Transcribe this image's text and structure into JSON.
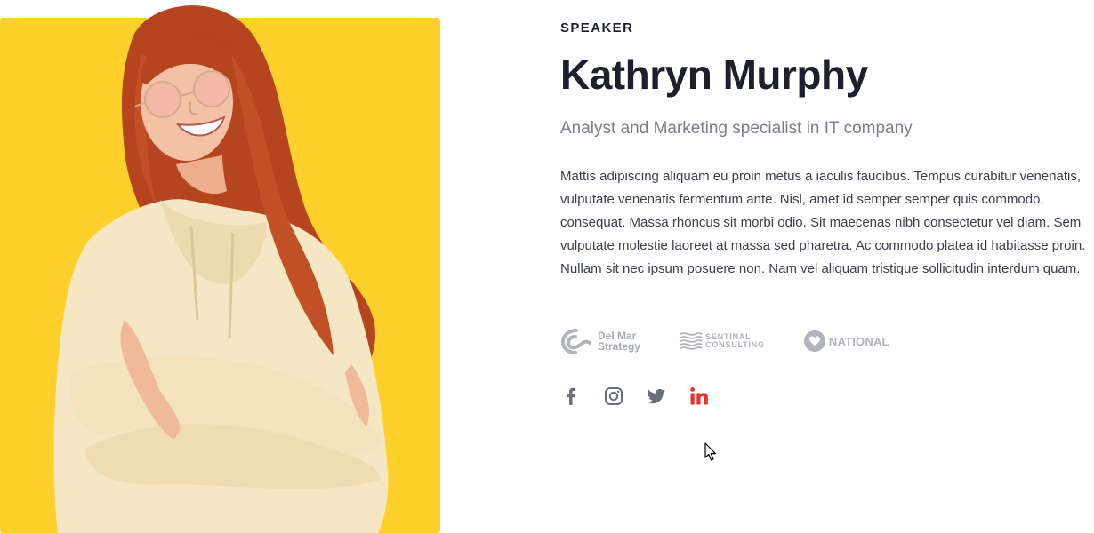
{
  "speaker": {
    "eyebrow": "SPEAKER",
    "name": "Kathryn Murphy",
    "role": "Analyst and Marketing specialist in IT company",
    "bio": "Mattis adipiscing aliquam eu proin metus a iaculis faucibus. Tempus curabitur venenatis, vulputate venenatis fermentum ante. Nisl, amet id semper semper quis commodo, consequat. Massa rhoncus sit morbi odio. Sit maecenas nibh consectetur vel diam. Sem vulputate molestie laoreet at massa sed pharetra. Ac commodo platea id habitasse proin. Nullam sit nec ipsum posuere non. Nam vel aliquam tristique sollicitudin interdum quam."
  },
  "partners": [
    {
      "icon": "del-mar-strategy-logo",
      "line1": "Del Mar",
      "line2": "Strategy"
    },
    {
      "icon": "sentinal-consulting-logo",
      "line1": "SENTINAL",
      "line2": "CONSULTING"
    },
    {
      "icon": "national-logo",
      "label": "NATIONAL"
    }
  ],
  "socials": [
    {
      "icon": "facebook-icon",
      "color": "#6b6e76"
    },
    {
      "icon": "instagram-icon",
      "color": "#6b6e76"
    },
    {
      "icon": "twitter-icon",
      "color": "#6b6e76"
    },
    {
      "icon": "linkedin-icon",
      "color": "#e5332a",
      "state": "hover"
    }
  ],
  "colors": {
    "card_background": "#ffd02c",
    "heading": "#1d1f2b",
    "muted": "#7c7f87",
    "accent": "#e5332a"
  }
}
